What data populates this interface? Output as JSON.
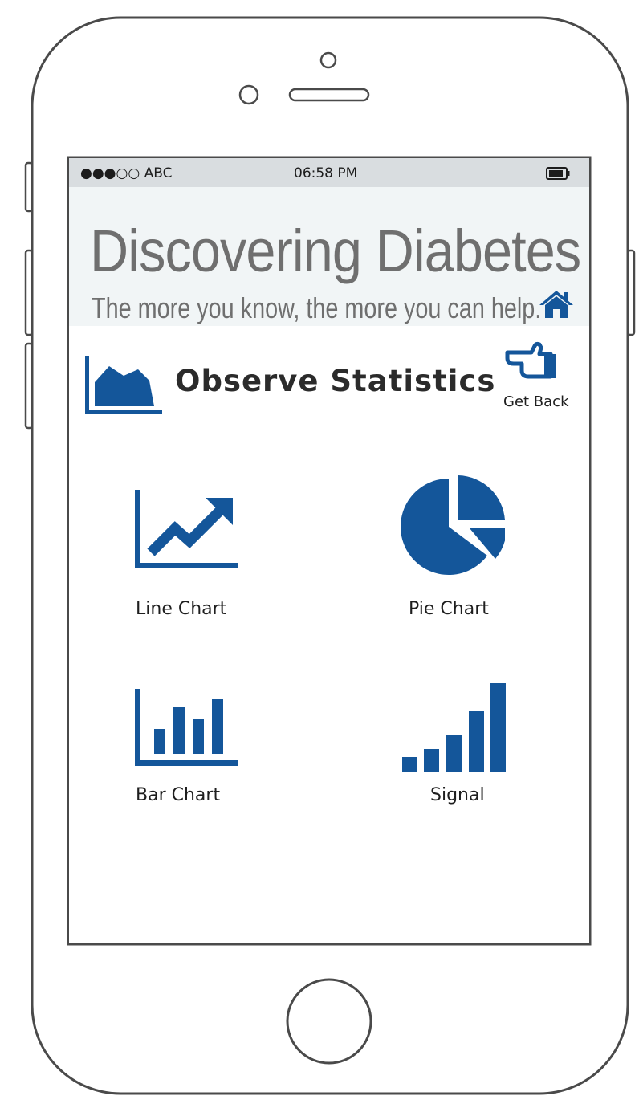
{
  "status_bar": {
    "carrier": "●●●○○ ABC",
    "time": "06:58 PM",
    "battery_icon": "battery-icon"
  },
  "banner": {
    "title": "Discovering Diabetes",
    "tagline": "The more you know, the more you can help.",
    "home_icon": "home-icon"
  },
  "section": {
    "title": "Observe Statistics",
    "icon": "area-chart-icon"
  },
  "get_back": {
    "label": "Get Back",
    "icon": "pointing-hand-icon"
  },
  "tiles": [
    {
      "label": "Line Chart",
      "icon": "line-chart-icon"
    },
    {
      "label": "Pie Chart",
      "icon": "pie-chart-icon"
    },
    {
      "label": "Bar Chart",
      "icon": "bar-chart-icon"
    },
    {
      "label": "Signal",
      "icon": "signal-icon"
    }
  ],
  "colors": {
    "accent": "#14569a",
    "status_bar": "#d9dde0",
    "banner": "#f1f5f6",
    "text_gray": "#6f6f6f"
  }
}
